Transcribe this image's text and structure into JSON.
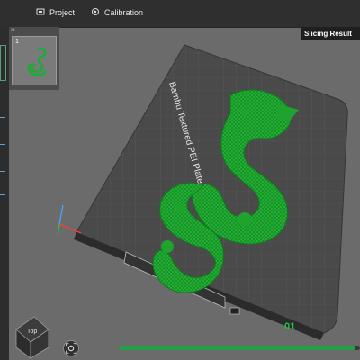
{
  "tabs": [
    {
      "label": "Project",
      "icon": "project-icon"
    },
    {
      "label": "Calibration",
      "icon": "calibration-icon"
    }
  ],
  "panel": {
    "title": "Slicing Result"
  },
  "plate": {
    "number": "1",
    "bed_label": "Bambu Textured PEI Plate",
    "plate_id": "01"
  },
  "view_cube": {
    "label": "Top"
  },
  "progress": {
    "fraction": 0.98
  },
  "colors": {
    "model": "#1fa82f",
    "accent": "#22a14a"
  }
}
